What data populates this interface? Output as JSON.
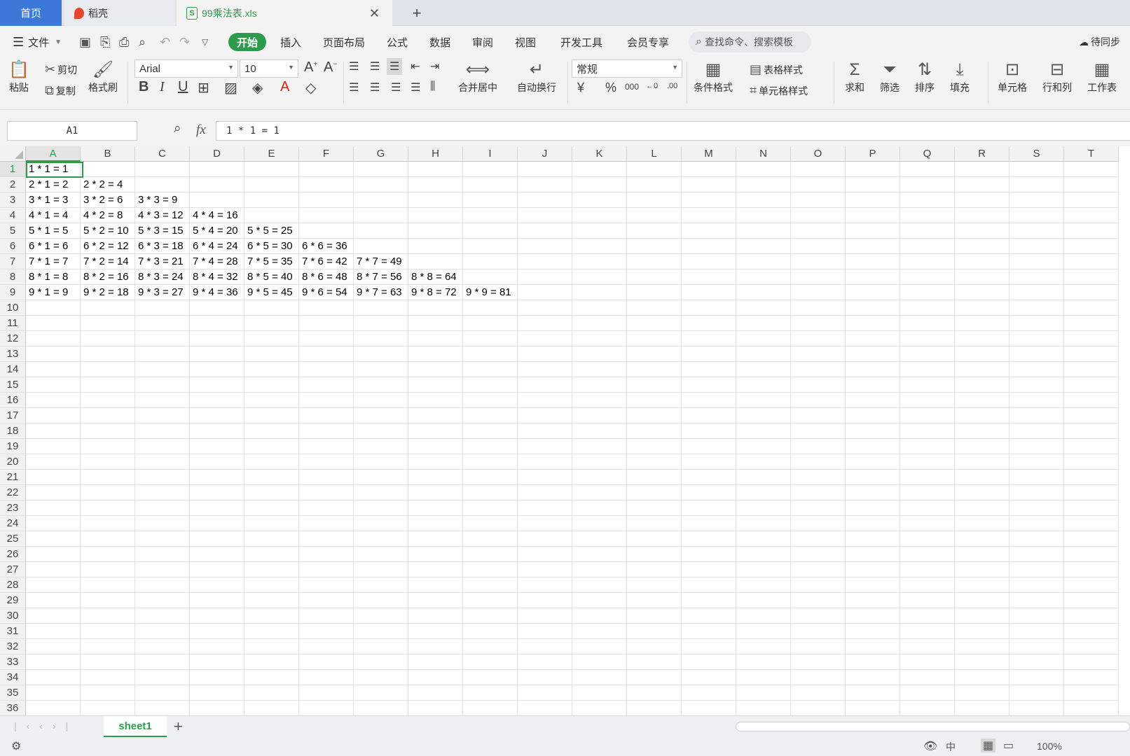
{
  "tabs": {
    "home": "首页",
    "daoke": "稻壳",
    "file": "99乘法表.xls",
    "add": "+"
  },
  "menu": {
    "file": "文件",
    "items": [
      "开始",
      "插入",
      "页面布局",
      "公式",
      "数据",
      "审阅",
      "视图",
      "开发工具",
      "会员专享"
    ],
    "search_placeholder": "查找命令、搜索模板",
    "sync": "待同步"
  },
  "ribbon": {
    "paste": "粘贴",
    "cut": "剪切",
    "copy": "复制",
    "format_painter": "格式刷",
    "font_name": "Arial",
    "font_size": "10",
    "merge_center": "合并居中",
    "wrap": "自动换行",
    "number_format": "常规",
    "cond_format": "条件格式",
    "table_style": "表格样式",
    "cell_style": "单元格样式",
    "sum": "求和",
    "filter": "筛选",
    "sort": "排序",
    "fill": "填充",
    "cells": "单元格",
    "rowcol": "行和列",
    "worksheet": "工作表"
  },
  "formula_bar": {
    "name_box": "A1",
    "fx": "fx",
    "content": "1 * 1 = 1"
  },
  "columns": [
    "A",
    "B",
    "C",
    "D",
    "E",
    "F",
    "G",
    "H",
    "I",
    "J",
    "K",
    "L",
    "M",
    "N",
    "O",
    "P",
    "Q",
    "R",
    "S",
    "T"
  ],
  "rows": [
    [
      "1 * 1 = 1"
    ],
    [
      "2 * 1 = 2",
      "2 * 2 = 4"
    ],
    [
      "3 * 1 = 3",
      "3 * 2 = 6",
      "3 * 3 = 9"
    ],
    [
      "4 * 1 = 4",
      "4 * 2 = 8",
      "4 * 3 = 12",
      "4 * 4 = 16"
    ],
    [
      "5 * 1 = 5",
      "5 * 2 = 10",
      "5 * 3 = 15",
      "5 * 4 = 20",
      "5 * 5 = 25"
    ],
    [
      "6 * 1 = 6",
      "6 * 2 = 12",
      "6 * 3 = 18",
      "6 * 4 = 24",
      "6 * 5 = 30",
      "6 * 6 = 36"
    ],
    [
      "7 * 1 = 7",
      "7 * 2 = 14",
      "7 * 3 = 21",
      "7 * 4 = 28",
      "7 * 5 = 35",
      "7 * 6 = 42",
      "7 * 7 = 49"
    ],
    [
      "8 * 1 = 8",
      "8 * 2 = 16",
      "8 * 3 = 24",
      "8 * 4 = 32",
      "8 * 5 = 40",
      "8 * 6 = 48",
      "8 * 7 = 56",
      "8 * 8 = 64"
    ],
    [
      "9 * 1 = 9",
      "9 * 2 = 18",
      "9 * 3 = 27",
      "9 * 4 = 36",
      "9 * 5 = 45",
      "9 * 6 = 54",
      "9 * 7 = 63",
      "9 * 8 = 72",
      "9 * 9 = 81"
    ]
  ],
  "visible_row_count": 36,
  "sheet": {
    "name": "sheet1",
    "add": "+"
  },
  "status": {
    "zoom": "100%"
  },
  "colors": {
    "accent": "#2c9c4c",
    "home_tab": "#3b78d8"
  }
}
